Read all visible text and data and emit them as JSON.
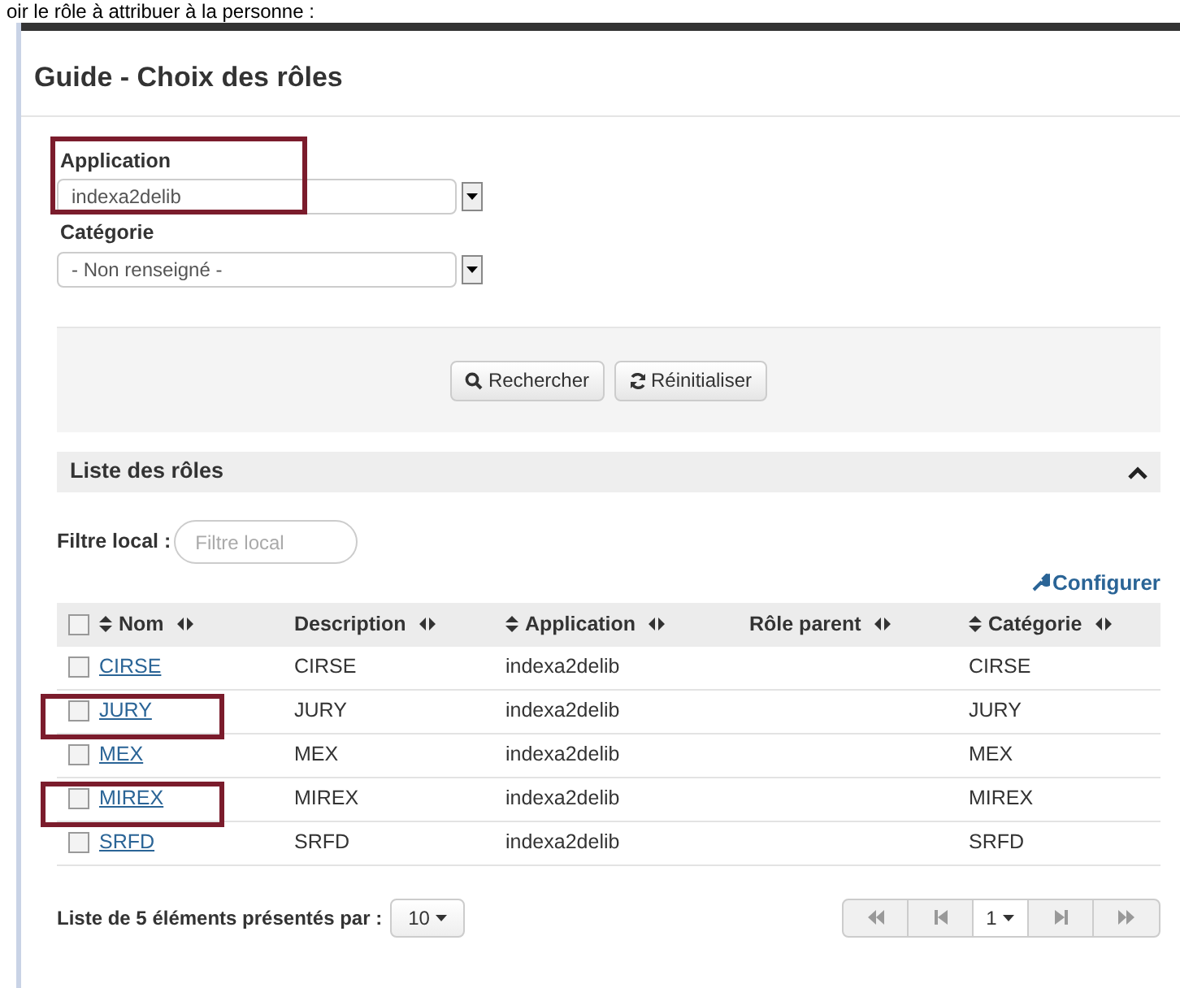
{
  "caption": "oir le rôle à attribuer à la personne :",
  "title": "Guide - Choix des rôles",
  "fields": [
    {
      "label": "Application",
      "value": "indexa2delib",
      "highlighted": true
    },
    {
      "label": "Catégorie",
      "value": "- Non renseigné -",
      "highlighted": false
    }
  ],
  "buttons": [
    {
      "label": "Rechercher",
      "kind": "search"
    },
    {
      "label": "Réinitialiser",
      "kind": "reset"
    }
  ],
  "list": {
    "title": "Liste des rôles",
    "expanded": true,
    "filter_label": "Filtre local :",
    "filter_placeholder": "Filtre local",
    "configure": "Configurer"
  },
  "table": {
    "select_all_checked": false,
    "columns": [
      {
        "label": "Nom",
        "sortable": true
      },
      {
        "label": "Description",
        "sortable": false
      },
      {
        "label": "Application",
        "sortable": true
      },
      {
        "label": "Rôle parent",
        "sortable": false
      },
      {
        "label": "Catégorie",
        "sortable": true
      }
    ],
    "rows": [
      {
        "checked": false,
        "highlighted": false,
        "cells": [
          "CIRSE",
          "CIRSE",
          "indexa2delib",
          "",
          "CIRSE"
        ]
      },
      {
        "checked": false,
        "highlighted": true,
        "cells": [
          "JURY",
          "JURY",
          "indexa2delib",
          "",
          "JURY"
        ]
      },
      {
        "checked": false,
        "highlighted": false,
        "cells": [
          "MEX",
          "MEX",
          "indexa2delib",
          "",
          "MEX"
        ]
      },
      {
        "checked": false,
        "highlighted": true,
        "cells": [
          "MIREX",
          "MIREX",
          "indexa2delib",
          "",
          "MIREX"
        ]
      },
      {
        "checked": false,
        "highlighted": false,
        "cells": [
          "SRFD",
          "SRFD",
          "indexa2delib",
          "",
          "SRFD"
        ]
      }
    ]
  },
  "footer": {
    "summary": "Liste de 5 éléments présentés par :",
    "page_size": "10",
    "page": "1"
  }
}
